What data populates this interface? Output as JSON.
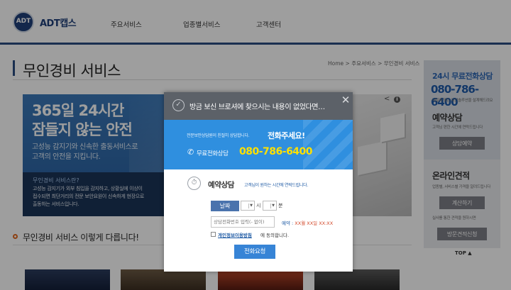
{
  "header": {
    "logo_badge_top": "ADT",
    "logo_text": "ADT캡스",
    "nav": [
      "주요서비스",
      "업종별서비스",
      "고객센터"
    ]
  },
  "page": {
    "title": "무인경비 서비스",
    "breadcrumb": "Home > 주요서비스 > 무인경비 서비스"
  },
  "hero": {
    "headline_1": "365일 24시간",
    "headline_2": "잠들지 않는 안전",
    "sub_1": "고성능 감지기와 신속한 출동서비스로",
    "sub_2": "고객의 안전을 지킵니다.",
    "q_title": "무인경비 서비스란?",
    "desc_1": "고성능 감지기가 외부 침입을 감지하고, 상황실에 이상이",
    "desc_2": "접수되면 최단거리의 전문 보안요원이 신속하게 현장으로",
    "desc_3": "출동하는 서비스입니다."
  },
  "section2": {
    "title": "무인경비 서비스 이렇게 다릅니다!"
  },
  "sidebar": {
    "hotline_title": "24시 무료전화상담",
    "hotline_phone": "080-786-6400",
    "hotline_note": "내일에 맞는 보안솔루션을 설계해드려요",
    "resv_title": "예약상담",
    "resv_note": "고객님 편한 시간에 연락드립니다",
    "resv_button": "상담예약",
    "quote_title": "온라인견적",
    "quote_note": "업종별, 서비스별 가격을 알려드립니다",
    "quote_button": "계산하기",
    "visit_note": "실사를 통한 견적을 원하시면",
    "visit_button": "방문견적신청",
    "top_link": "TOP ▲"
  },
  "modal": {
    "title": "방금 보신 브로셔에 찾으시는 내용이 없었다면…",
    "banner_sub": "전문보안상담원이 친절히 상담합니다.",
    "banner_em": "전화주세요!",
    "phone_label": "무료전화상담",
    "phone_number": "080-786-6400",
    "resv_title": "예약상담",
    "resv_desc": "고객님이 원하는 시간에 연락드립니다.",
    "date_button": "날짜",
    "hour_label": "시",
    "minute_label": "분",
    "phone_placeholder": "상담전화번호 입력(- 없이)",
    "resv_time_label": "예약 :",
    "resv_time_value": "XX월 XX일 XX:XX",
    "consent_link": "개인정보이용방침",
    "consent_text": "에 동의합니다.",
    "submit_button": "전화요청"
  },
  "colors": {
    "brand_navy": "#1f3f7a",
    "hero_blue": "#3b78b8",
    "modal_header": "#5c6168",
    "banner_blue": "#2f8fdf",
    "phone_yellow": "#ffe000",
    "accent_orange": "#e2691f"
  },
  "icons": {
    "check": "check-circle-icon",
    "close": "close-icon",
    "phone": "phone-icon",
    "reservation": "clock-icon",
    "share": "share-icon",
    "info": "info-icon"
  }
}
